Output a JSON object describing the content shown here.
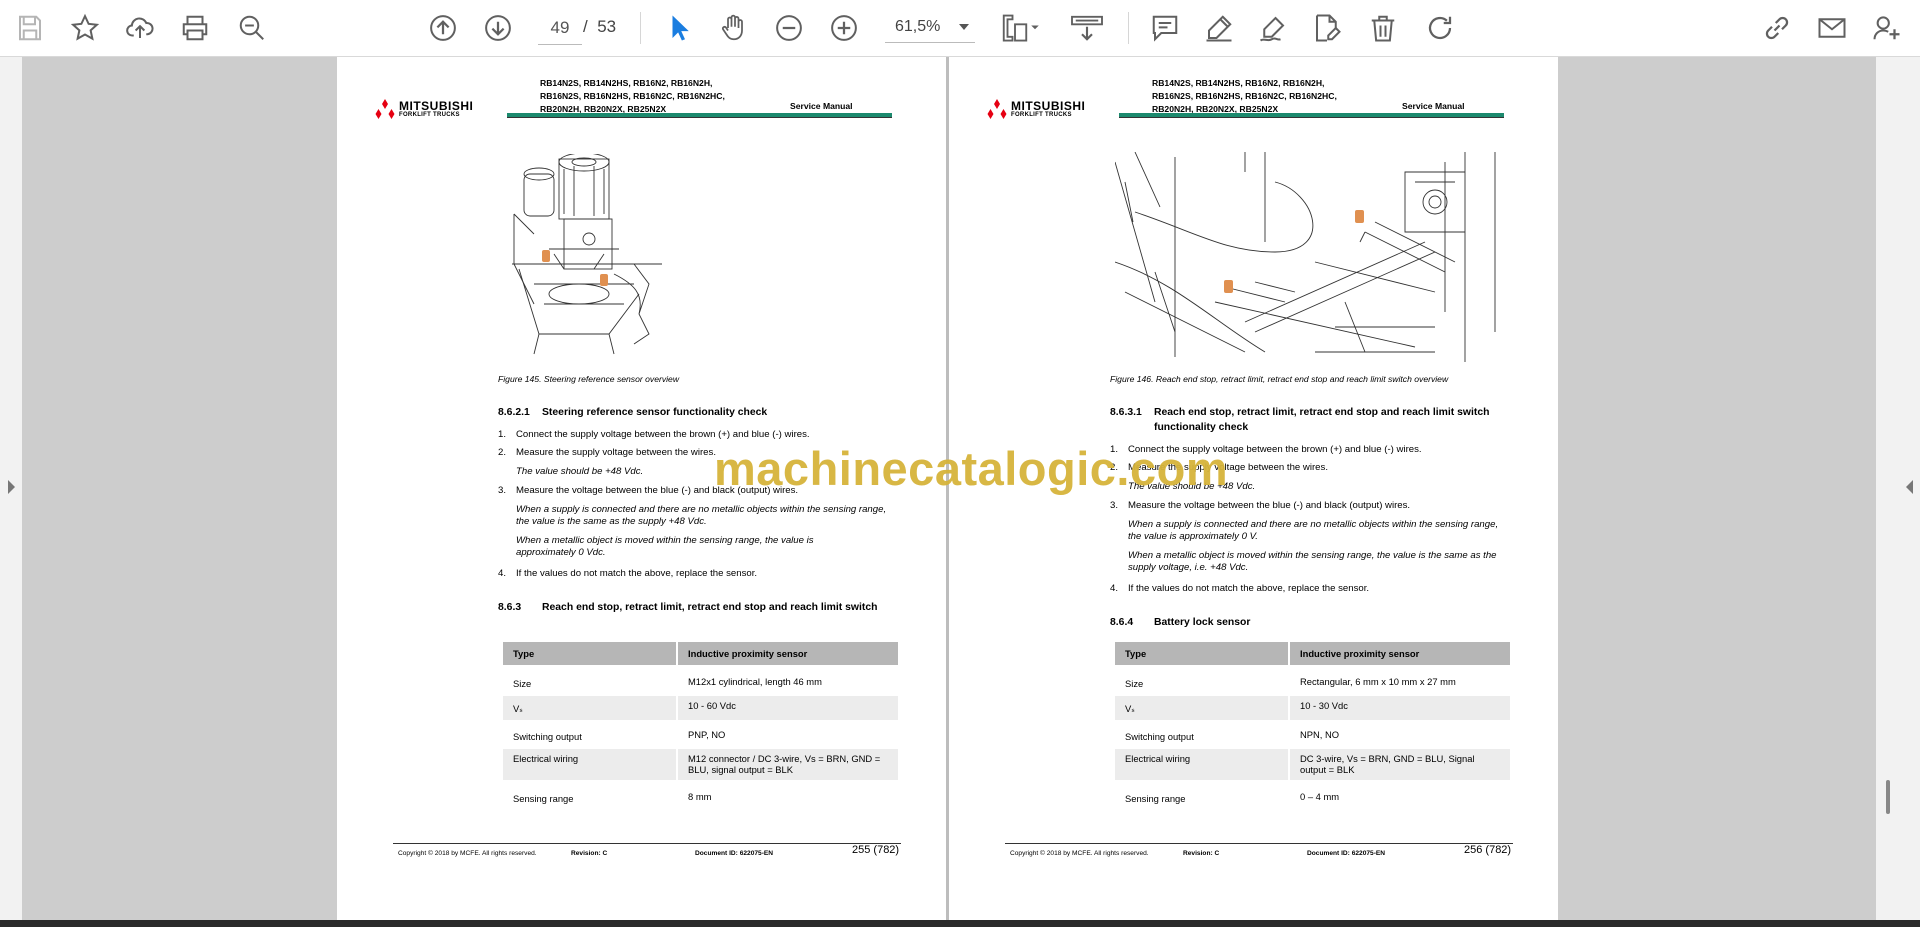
{
  "toolbar": {
    "page_current": "49",
    "page_separator": "/",
    "page_total": "53",
    "zoom": "61,5%",
    "colors": {
      "blue": "#1a7de0",
      "icon": "#606060"
    }
  },
  "watermark": "machinecatalogic.com",
  "common": {
    "logo_main": "MITSUBISHI",
    "logo_sub": "FORKLIFT TRUCKS",
    "models": [
      "RB14N2S, RB14N2HS, RB16N2, RB16N2H,",
      "RB16N2S, RB16N2HS, RB16N2C, RB16N2HC,",
      "RB20N2H, RB20N2X, RB25N2X"
    ],
    "service_manual": "Service Manual",
    "copyright": "Copyright © 2018 by MCFE. All rights reserved.",
    "revision": "Revision: C",
    "document_id": "Document ID: 622075-EN",
    "accent": "#1c8a6e"
  },
  "left_page": {
    "caption": "Figure 145. Steering reference sensor overview",
    "h1_num": "8.6.2.1",
    "h1_txt": "Steering reference sensor functionality check",
    "steps": [
      {
        "n": "1.",
        "t": "Connect the supply voltage between the brown (+) and blue (-) wires."
      },
      {
        "n": "2.",
        "t": "Measure the supply voltage between the wires."
      },
      {
        "n": "3.",
        "t": "Measure the voltage between the blue (-) and black (output) wires."
      },
      {
        "n": "4.",
        "t": "If the values do not match the above, replace the sensor."
      }
    ],
    "notes": [
      "The value should be +48 Vdc.",
      "When a supply is connected and there are no metallic objects within the sensing range, the value is the same as the supply +48 Vdc.",
      "When a metallic object is moved within the sensing range, the value is approximately 0 Vdc."
    ],
    "h2_num": "8.6.3",
    "h2_txt": "Reach end stop, retract limit, retract end stop and reach limit switch",
    "table": {
      "header": [
        "Type",
        "Inductive proximity sensor"
      ],
      "rows": [
        [
          "Size",
          "M12x1 cylindrical, length 46 mm"
        ],
        [
          "Vₛ",
          "10 - 60 Vdc"
        ],
        [
          "Switching output",
          "PNP, NO"
        ],
        [
          "Electrical wiring",
          "M12 connector / DC 3-wire, Vs = BRN, GND = BLU, signal output = BLK"
        ],
        [
          "Sensing range",
          "8 mm"
        ]
      ]
    },
    "page_number": "255 (782)"
  },
  "right_page": {
    "caption": "Figure 146. Reach end stop, retract limit, retract end stop and reach limit switch overview",
    "h1_num": "8.6.3.1",
    "h1_txt": "Reach end stop, retract limit, retract end stop and reach limit switch functionality check",
    "steps": [
      {
        "n": "1.",
        "t": "Connect the supply voltage between the brown (+) and blue (-) wires."
      },
      {
        "n": "2.",
        "t": "Measure the supply voltage between the wires."
      },
      {
        "n": "3.",
        "t": "Measure the voltage between the blue (-) and black (output) wires."
      },
      {
        "n": "4.",
        "t": "If the values do not match the above, replace the sensor."
      }
    ],
    "notes": [
      "The value should be +48 Vdc.",
      "When a supply is connected and there are no metallic objects within the sensing range, the value is approximately 0 V.",
      "When a metallic object is moved within the sensing range, the value is the same as the supply voltage, i.e. +48 Vdc."
    ],
    "h2_num": "8.6.4",
    "h2_txt": "Battery lock sensor",
    "table": {
      "header": [
        "Type",
        "Inductive proximity sensor"
      ],
      "rows": [
        [
          "Size",
          "Rectangular, 6 mm x 10 mm x 27 mm"
        ],
        [
          "Vₛ",
          "10 - 30 Vdc"
        ],
        [
          "Switching output",
          "NPN, NO"
        ],
        [
          "Electrical wiring",
          "DC 3-wire, Vs = BRN, GND = BLU, Signal output = BLK"
        ],
        [
          "Sensing range",
          "0 – 4 mm"
        ]
      ]
    },
    "page_number": "256 (782)"
  }
}
